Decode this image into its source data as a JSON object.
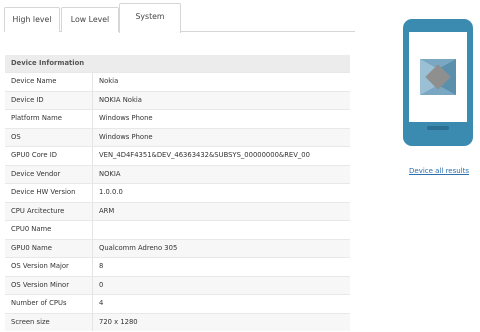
{
  "tabs": [
    {
      "label": "High level"
    },
    {
      "label": "Low Level"
    },
    {
      "label": "System"
    }
  ],
  "info": {
    "header": "Device Information",
    "rows": [
      {
        "label": "Device Name",
        "value": "Nokia"
      },
      {
        "label": "Device ID",
        "value": "NOKIA Nokia"
      },
      {
        "label": "Platform Name",
        "value": "Windows Phone"
      },
      {
        "label": "OS",
        "value": "Windows Phone"
      },
      {
        "label": "GPU0 Core ID",
        "value": "VEN_4D4F4351&DEV_46363432&SUBSYS_00000000&REV_00"
      },
      {
        "label": "Device Vendor",
        "value": "NOKIA"
      },
      {
        "label": "Device HW Version",
        "value": "1.0.0.0"
      },
      {
        "label": "CPU Arcitecture",
        "value": "ARM"
      },
      {
        "label": "CPU0 Name",
        "value": ""
      },
      {
        "label": "GPU0 Name",
        "value": "Qualcomm Adreno 305"
      },
      {
        "label": "OS Version Major",
        "value": "8"
      },
      {
        "label": "OS Version Minor",
        "value": "0"
      },
      {
        "label": "Number of CPUs",
        "value": "4"
      },
      {
        "label": "Screen size",
        "value": "720 x 1280"
      }
    ]
  },
  "sidebar": {
    "device_icon": "phone-icon",
    "link_label": "Device all results",
    "phone_color": "#3b8bb0"
  }
}
